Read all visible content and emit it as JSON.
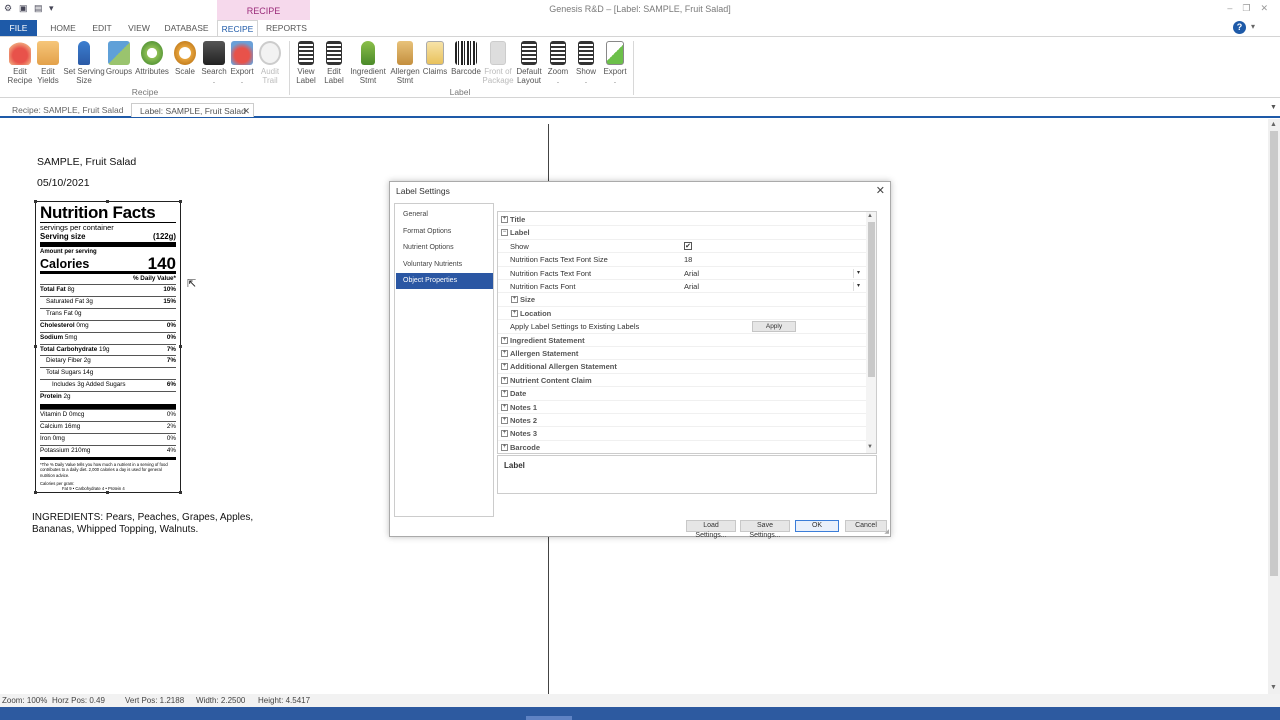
{
  "window": {
    "title": "Genesis R&D – [Label: SAMPLE, Fruit Salad]",
    "context_tab": "RECIPE"
  },
  "menu": {
    "file": "FILE",
    "items": [
      "HOME",
      "EDIT",
      "VIEW",
      "DATABASE",
      "RECIPE",
      "REPORTS"
    ]
  },
  "ribbon": {
    "recipe_group": "Recipe",
    "label_group": "Label",
    "buttons": [
      {
        "label": "Edit\nRecipe"
      },
      {
        "label": "Edit\nYields"
      },
      {
        "label": "Set Serving\nSize"
      },
      {
        "label": "Groups"
      },
      {
        "label": "Attributes"
      },
      {
        "label": "Scale"
      },
      {
        "label": "Search\n."
      },
      {
        "label": "Export\n."
      },
      {
        "label": "Audit\nTrail"
      },
      {
        "label": "View\nLabel"
      },
      {
        "label": "Edit\nLabel"
      },
      {
        "label": "Ingredient\nStmt"
      },
      {
        "label": "Allergen\nStmt"
      },
      {
        "label": "Claims"
      },
      {
        "label": "Barcode"
      },
      {
        "label": "Front of\nPackage"
      },
      {
        "label": "Default\nLayout"
      },
      {
        "label": "Zoom\n."
      },
      {
        "label": "Show\n."
      },
      {
        "label": "Export\n."
      }
    ]
  },
  "doc_tabs": {
    "tab1": "Recipe: SAMPLE, Fruit Salad",
    "tab2": "Label: SAMPLE, Fruit Salad",
    "close": "✕"
  },
  "label": {
    "title": "SAMPLE, Fruit Salad",
    "date": "05/10/2021",
    "ingredients": "INGREDIENTS: Pears, Peaches, Grapes, Apples, Bananas, Whipped Topping, Walnuts."
  },
  "nutrition": {
    "header": "Nutrition Facts",
    "servings": "servings per container",
    "serving_size_label": "Serving size",
    "serving_size_value": "(122g)",
    "amount_per_serving": "Amount per serving",
    "calories_label": "Calories",
    "calories_value": "140",
    "dv_header": "% Daily Value*",
    "rows": [
      {
        "name": "Total Fat",
        "amt": "8g",
        "dv": "10%",
        "bold": true,
        "indent": 0
      },
      {
        "name": "Saturated Fat",
        "amt": "3g",
        "dv": "15%",
        "bold": false,
        "indent": 1
      },
      {
        "name": "Trans Fat",
        "amt": "0g",
        "dv": "",
        "bold": false,
        "indent": 1
      },
      {
        "name": "Cholesterol",
        "amt": "0mg",
        "dv": "0%",
        "bold": true,
        "indent": 0
      },
      {
        "name": "Sodium",
        "amt": "5mg",
        "dv": "0%",
        "bold": true,
        "indent": 0
      },
      {
        "name": "Total Carbohydrate",
        "amt": "19g",
        "dv": "7%",
        "bold": true,
        "indent": 0
      },
      {
        "name": "Dietary Fiber",
        "amt": "2g",
        "dv": "7%",
        "bold": false,
        "indent": 1
      },
      {
        "name": "Total Sugars",
        "amt": "14g",
        "dv": "",
        "bold": false,
        "indent": 1
      },
      {
        "name": "Includes 3g Added Sugars",
        "amt": "",
        "dv": "6%",
        "bold": false,
        "indent": 2
      },
      {
        "name": "Protein",
        "amt": "2g",
        "dv": "",
        "bold": true,
        "indent": 0
      }
    ],
    "vitamins": [
      {
        "name": "Vitamin D",
        "amt": "0mcg",
        "dv": "0%"
      },
      {
        "name": "Calcium",
        "amt": "16mg",
        "dv": "2%"
      },
      {
        "name": "Iron",
        "amt": "0mg",
        "dv": "0%"
      },
      {
        "name": "Potassium",
        "amt": "210mg",
        "dv": "4%"
      }
    ],
    "footnote": "*The % Daily Value tells you how much a nutrient in a serving of food contributes to a daily diet. 2,000 calories a day is used for general nutrition advice.",
    "cal_per_gram": "Calories per gram:",
    "cal_per_gram_values": "Fat 9  •  Carbohydrate 4  •  Protein 4"
  },
  "dialog": {
    "title": "Label Settings",
    "close": "✕",
    "nav": [
      "General",
      "Format Options",
      "Nutrient Options",
      "Voluntary Nutrients",
      "Object Properties"
    ],
    "selected_nav": "Object Properties",
    "grid": [
      {
        "name": "Title",
        "type": "cat",
        "exp": "+",
        "level": 0
      },
      {
        "name": "Label",
        "type": "cat",
        "exp": "−",
        "level": 0
      },
      {
        "name": "Show",
        "type": "check",
        "value": "✔",
        "level": 1
      },
      {
        "name": "Nutrition Facts Text Font Size",
        "type": "text",
        "value": "18",
        "level": 1
      },
      {
        "name": "Nutrition Facts Text Font",
        "type": "dropdown",
        "value": "Arial",
        "level": 1
      },
      {
        "name": "Nutrition Facts Font",
        "type": "dropdown",
        "value": "Arial",
        "level": 1
      },
      {
        "name": "Size",
        "type": "cat",
        "exp": "+",
        "level": 1
      },
      {
        "name": "Location",
        "type": "cat",
        "exp": "+",
        "level": 1
      },
      {
        "name": "Apply Label Settings to Existing Labels",
        "type": "button",
        "value": "Apply",
        "level": 1
      },
      {
        "name": "Ingredient Statement",
        "type": "cat",
        "exp": "+",
        "level": 0
      },
      {
        "name": "Allergen Statement",
        "type": "cat",
        "exp": "+",
        "level": 0
      },
      {
        "name": "Additional Allergen Statement",
        "type": "cat",
        "exp": "+",
        "level": 0
      },
      {
        "name": "Nutrient Content Claim",
        "type": "cat",
        "exp": "+",
        "level": 0
      },
      {
        "name": "Date",
        "type": "cat",
        "exp": "+",
        "level": 0
      },
      {
        "name": "Notes 1",
        "type": "cat",
        "exp": "+",
        "level": 0
      },
      {
        "name": "Notes 2",
        "type": "cat",
        "exp": "+",
        "level": 0
      },
      {
        "name": "Notes 3",
        "type": "cat",
        "exp": "+",
        "level": 0
      },
      {
        "name": "Barcode",
        "type": "cat",
        "exp": "+",
        "level": 0
      }
    ],
    "description": "Label",
    "buttons": {
      "load": "Load Settings...",
      "save": "Save Settings...",
      "ok": "OK",
      "cancel": "Cancel"
    }
  },
  "status": {
    "zoom": "Zoom: 100%",
    "horz": "Horz Pos: 0.49",
    "vert": "Vert Pos: 1.2188",
    "width": "Width: 2.2500",
    "height": "Height: 4.5417"
  },
  "colors": {
    "accent": "#1e5aa8",
    "selected_nav": "#2b57a3",
    "context_tab_bg": "#f6d9ec"
  }
}
